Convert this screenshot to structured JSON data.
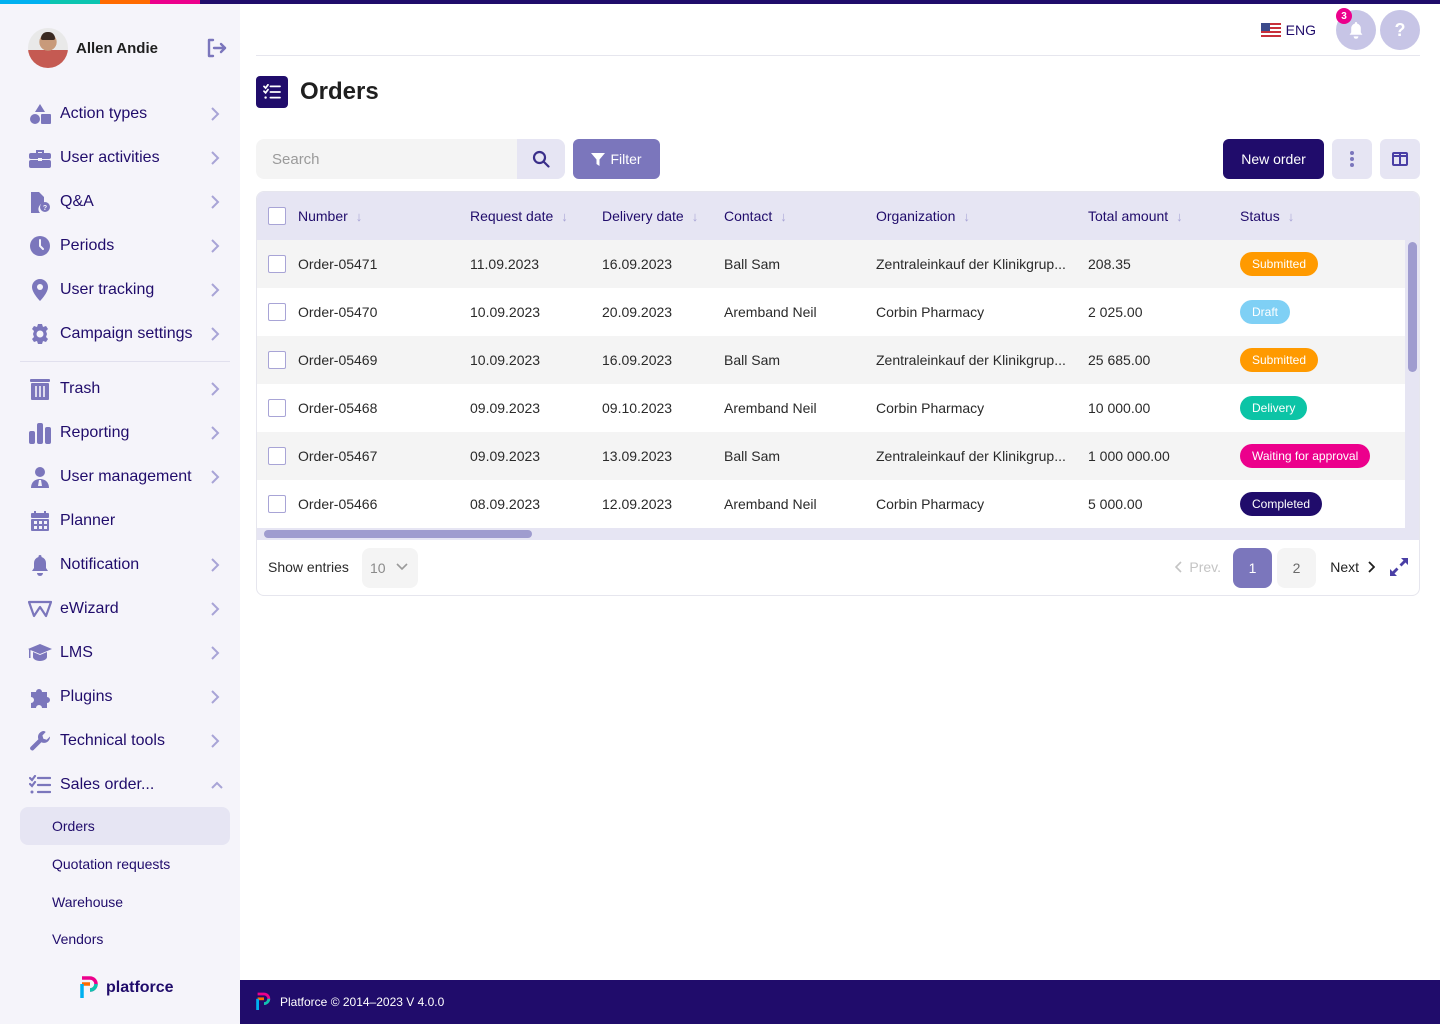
{
  "brand": {
    "stripe_colors": [
      "#00b0f0",
      "#0cc4b0",
      "#ff6a00",
      "#ec008c",
      "#200c6b"
    ],
    "primary": "#200c6b",
    "accent": "#7b76bc",
    "logo_text": "platforce"
  },
  "user": {
    "name": "Allen Andie",
    "logout_icon": "logout-icon"
  },
  "sidebar": {
    "items": [
      {
        "label": "Action types",
        "icon": "shapes-icon",
        "has_chevron": true
      },
      {
        "label": "User activities",
        "icon": "briefcase-icon",
        "has_chevron": true
      },
      {
        "label": "Q&A",
        "icon": "file-question-icon",
        "has_chevron": true
      },
      {
        "label": "Periods",
        "icon": "clock-icon",
        "has_chevron": true
      },
      {
        "label": "User tracking",
        "icon": "map-pin-icon",
        "has_chevron": true
      },
      {
        "label": "Campaign settings",
        "icon": "gear-icon",
        "has_chevron": true
      },
      {
        "label": "Trash",
        "icon": "trash-icon",
        "has_chevron": true
      },
      {
        "label": "Reporting",
        "icon": "bar-chart-icon",
        "has_chevron": true
      },
      {
        "label": "User management",
        "icon": "user-tie-icon",
        "has_chevron": true
      },
      {
        "label": "Planner",
        "icon": "calendar-icon",
        "has_chevron": false
      },
      {
        "label": "Notification",
        "icon": "bell-icon",
        "has_chevron": true
      },
      {
        "label": "eWizard",
        "icon": "ewizard-icon",
        "has_chevron": true
      },
      {
        "label": "LMS",
        "icon": "graduation-cap-icon",
        "has_chevron": true
      },
      {
        "label": "Plugins",
        "icon": "puzzle-icon",
        "has_chevron": true
      },
      {
        "label": "Technical tools",
        "icon": "wrench-icon",
        "has_chevron": true
      },
      {
        "label": "Sales order...",
        "icon": "checklist-icon",
        "has_chevron": true,
        "expanded": true
      }
    ],
    "sub_items": [
      {
        "label": "Orders",
        "active": true
      },
      {
        "label": "Quotation requests",
        "active": false
      },
      {
        "label": "Warehouse",
        "active": false
      },
      {
        "label": "Vendors",
        "active": false
      }
    ]
  },
  "topbar": {
    "language": "ENG",
    "notification_count": "3",
    "help_label": "?"
  },
  "page": {
    "title": "Orders",
    "search_placeholder": "Search",
    "search_value": "",
    "filter_label": "Filter",
    "new_order_label": "New order"
  },
  "table": {
    "columns": [
      "Number",
      "Request date",
      "Delivery date",
      "Contact",
      "Organization",
      "Total amount",
      "Status"
    ],
    "sort_glyph": "↓",
    "rows": [
      {
        "number": "Order-05471",
        "request_date": "11.09.2023",
        "delivery_date": "16.09.2023",
        "contact": "Ball Sam",
        "organization": "Zentraleinkauf der Klinikgrup...",
        "total": "208.35",
        "status": "Submitted",
        "status_color": "#ff9a00"
      },
      {
        "number": "Order-05470",
        "request_date": "10.09.2023",
        "delivery_date": "20.09.2023",
        "contact": "Aremband Neil",
        "organization": "Corbin Pharmacy",
        "total": "2 025.00",
        "status": "Draft",
        "status_color": "#7fd0f5"
      },
      {
        "number": "Order-05469",
        "request_date": "10.09.2023",
        "delivery_date": "16.09.2023",
        "contact": "Ball Sam",
        "organization": "Zentraleinkauf der Klinikgrup...",
        "total": "25 685.00",
        "status": "Submitted",
        "status_color": "#ff9a00"
      },
      {
        "number": "Order-05468",
        "request_date": "09.09.2023",
        "delivery_date": "09.10.2023",
        "contact": "Aremband Neil",
        "organization": "Corbin Pharmacy",
        "total": "10 000.00",
        "status": "Delivery",
        "status_color": "#0cc4a6"
      },
      {
        "number": "Order-05467",
        "request_date": "09.09.2023",
        "delivery_date": "13.09.2023",
        "contact": "Ball Sam",
        "organization": "Zentraleinkauf der Klinikgrup...",
        "total": "1 000 000.00",
        "status": "Waiting for approval",
        "status_color": "#ec008c"
      },
      {
        "number": "Order-05466",
        "request_date": "08.09.2023",
        "delivery_date": "12.09.2023",
        "contact": "Aremband Neil",
        "organization": "Corbin Pharmacy",
        "total": "5 000.00",
        "status": "Completed",
        "status_color": "#200c6b"
      }
    ]
  },
  "pagination": {
    "show_entries_label": "Show entries",
    "entries_value": "10",
    "prev_label": "Prev.",
    "pages": [
      "1",
      "2"
    ],
    "current_page": "1",
    "next_label": "Next"
  },
  "footer": {
    "text": "Platforce © 2014–2023 V 4.0.0"
  }
}
